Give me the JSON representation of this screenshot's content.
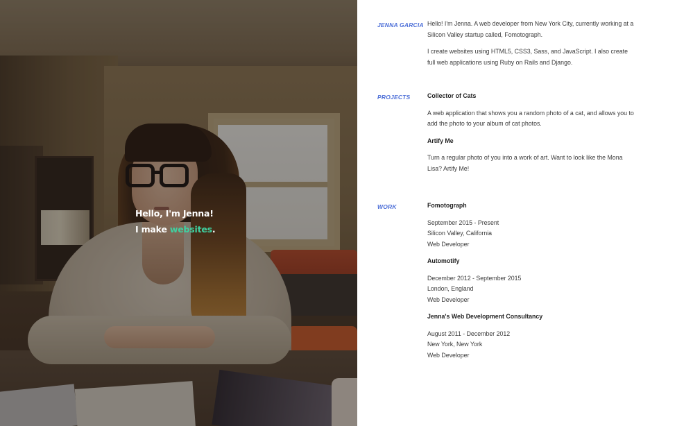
{
  "hero": {
    "greeting": "Hello, I'm Jenna!",
    "tagline_prefix": "I make ",
    "tagline_accent": "websites",
    "tagline_suffix": ".",
    "accent_color": "#3fd1a1"
  },
  "about": {
    "label": "JENNA GARCIA",
    "paragraphs": [
      "Hello! I'm Jenna. A web developer from New York City, currently working at a Silicon Valley startup called, Fomotograph.",
      "I create websites using HTML5, CSS3, Sass, and JavaScript. I also create full web applications using Ruby on Rails and Django."
    ]
  },
  "projects": {
    "label": "PROJECTS",
    "items": [
      {
        "title": "Collector of Cats",
        "description": "A web application that shows you a random photo of a cat, and allows you to add the photo to your album of cat photos."
      },
      {
        "title": "Artify Me",
        "description": "Turn a regular photo of you into a work of art. Want to look like the Mona Lisa? Artify Me!"
      }
    ]
  },
  "work": {
    "label": "WORK",
    "jobs": [
      {
        "company": "Fomotograph",
        "dates": "September 2015 - Present",
        "location": "Silicon Valley, California",
        "role": "Web Developer"
      },
      {
        "company": "Automotify",
        "dates": "December 2012 - September 2015",
        "location": "London, England",
        "role": "Web Developer"
      },
      {
        "company": "Jenna's Web Development Consultancy",
        "dates": "August 2011 - December 2012",
        "location": "New York, New York",
        "role": "Web Developer"
      }
    ]
  },
  "colors": {
    "label_blue": "#4d6fd8",
    "text": "#3a3a3a"
  }
}
